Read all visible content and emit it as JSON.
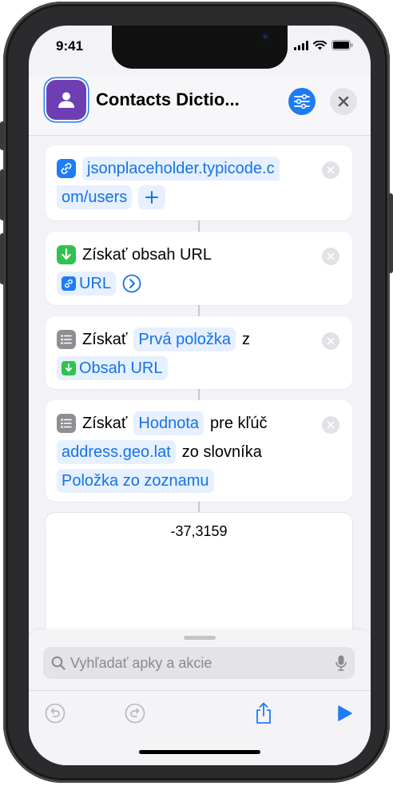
{
  "status_bar": {
    "time": "9:41"
  },
  "header": {
    "title": "Contacts Dictio..."
  },
  "actions": [
    {
      "url_part1": "jsonplaceholder.typicode.c",
      "url_part2": "om/users",
      "add_label": "+"
    },
    {
      "label": "Získať obsah URL",
      "param": "URL"
    },
    {
      "label": "Získať",
      "param1": "Prvá položka",
      "connector": "z",
      "param2": "Obsah URL"
    },
    {
      "label": "Získať",
      "param1": "Hodnota",
      "text1": "pre kľúč",
      "param2": "address.geo.lat",
      "text2": "zo slovníka",
      "param3": "Položka zo zoznamu"
    }
  ],
  "result": {
    "value": "-37,3159"
  },
  "search": {
    "placeholder": "Vyhľadať apky a akcie"
  },
  "colors": {
    "accent": "#1e7cf6",
    "app_icon": "#6e3fb3",
    "green": "#30c24d"
  }
}
